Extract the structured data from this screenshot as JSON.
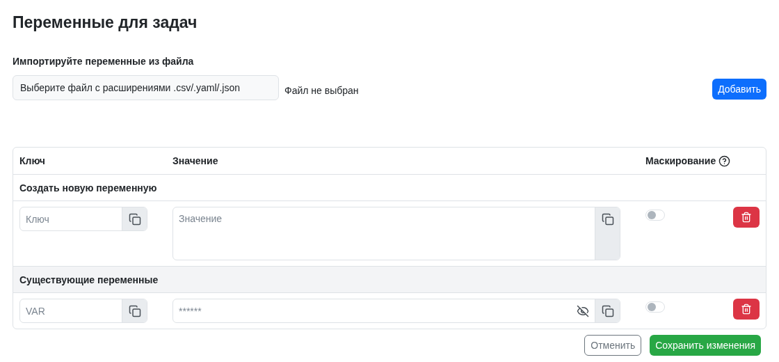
{
  "title": "Переменные для задач",
  "import": {
    "label": "Импортируйте переменные из файла",
    "button": "Выберите файл с расширениями .csv/.yaml/.json",
    "status": "Файл не выбран",
    "add": "Добавить"
  },
  "table": {
    "columns": [
      "Ключ",
      "Значение",
      "Маскирование"
    ],
    "sections": [
      {
        "title": "Создать новую переменную",
        "shaded": false,
        "rows": [
          {
            "key": {
              "placeholder": "Ключ"
            },
            "value": {
              "placeholder": "Значение",
              "multiline": true
            },
            "masked": false
          }
        ]
      },
      {
        "title": "Существующие переменные",
        "shaded": true,
        "rows": [
          {
            "key": {
              "value": "VAR"
            },
            "value": {
              "value": "******",
              "multiline": false,
              "hidden": true
            },
            "masked": false
          }
        ]
      }
    ]
  },
  "actions": {
    "cancel": "Отменить",
    "save": "Сохранить изменения"
  }
}
